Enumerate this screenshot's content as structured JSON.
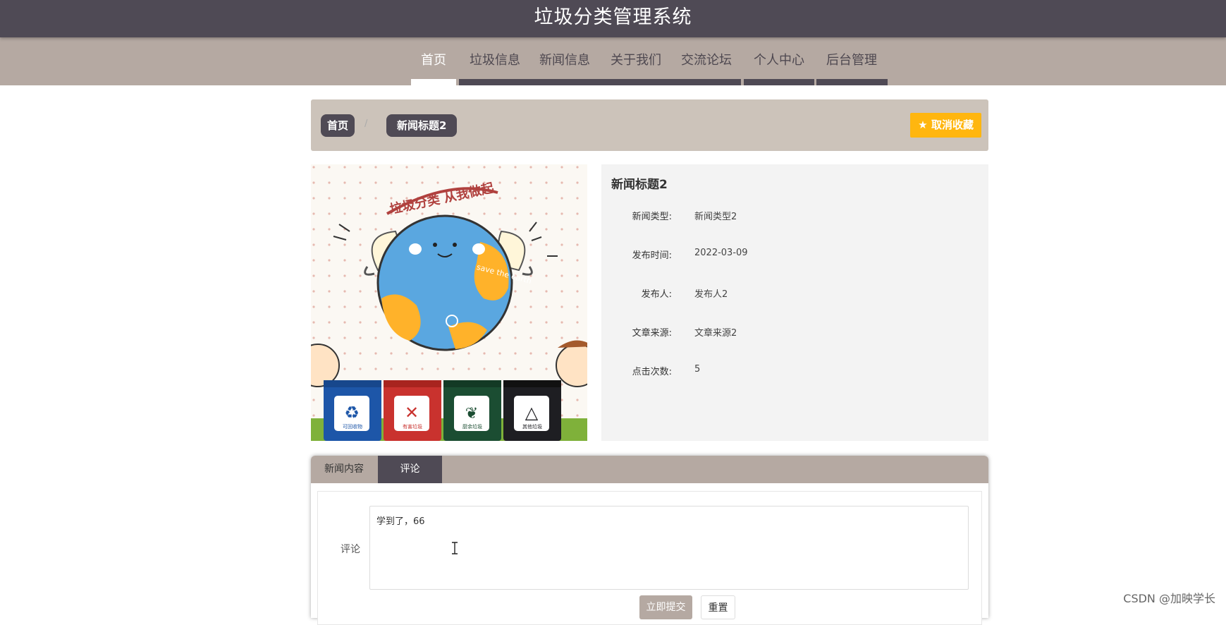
{
  "header": {
    "site_title": "垃圾分类管理系统"
  },
  "nav": {
    "items": [
      {
        "label": "首页",
        "active": true
      },
      {
        "label": "垃圾信息"
      },
      {
        "label": "新闻信息"
      },
      {
        "label": "关于我们"
      },
      {
        "label": "交流论坛"
      },
      {
        "label": "个人中心"
      },
      {
        "label": "后台管理"
      }
    ]
  },
  "breadcrumb": {
    "home": "首页",
    "separator": "/",
    "current": "新闻标题2"
  },
  "favorite_button": {
    "icon": "star-icon",
    "label": "取消收藏"
  },
  "image": {
    "alt": "垃圾分类 从我做起",
    "banner_text": "垃圾分类 从我做起",
    "globe_text": "save the earth",
    "bins": [
      "可回收物",
      "有害垃圾",
      "厨余垃圾",
      "其他垃圾"
    ]
  },
  "detail": {
    "title": "新闻标题2",
    "fields": [
      {
        "label": "新闻类型:",
        "value": "新闻类型2"
      },
      {
        "label": "发布时间:",
        "value": "2022-03-09"
      },
      {
        "label": "发布人:",
        "value": "发布人2"
      },
      {
        "label": "文章来源:",
        "value": "文章来源2"
      },
      {
        "label": "点击次数:",
        "value": "5"
      }
    ]
  },
  "tabs": [
    {
      "label": "新闻内容",
      "active": false
    },
    {
      "label": "评论",
      "active": true
    }
  ],
  "comment_form": {
    "label": "评论",
    "value": "学到了，66",
    "submit_label": "立即提交",
    "reset_label": "重置"
  },
  "watermark": "CSDN @加映学长",
  "colors": {
    "header_dark": "#4f4a55",
    "nav_taupe": "#b5a9a2",
    "breadcrumb_bg": "#ccc3ba",
    "favorite_yellow": "#ffb60f",
    "panel_gray": "#f3f3f3"
  }
}
